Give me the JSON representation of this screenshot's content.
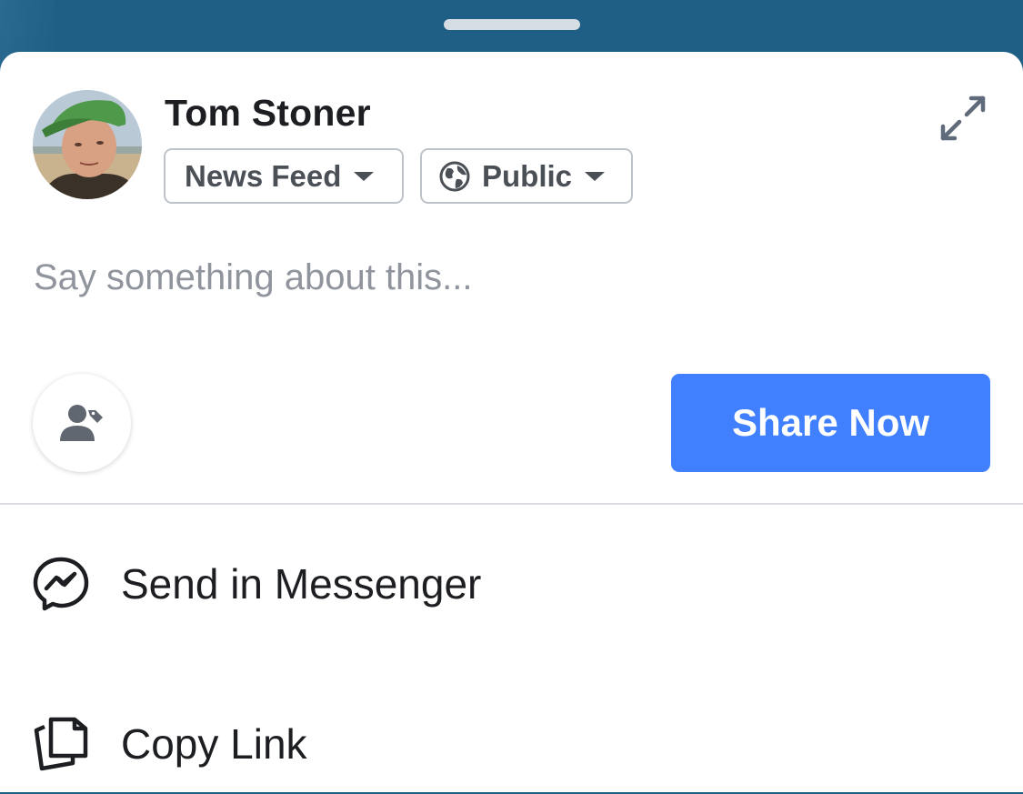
{
  "composer": {
    "user_name": "Tom Stoner",
    "audience_label": "News Feed",
    "privacy_label": "Public",
    "placeholder": "Say something about this...",
    "share_label": "Share Now"
  },
  "actions": [
    {
      "label": "Send in Messenger",
      "icon": "messenger-icon"
    },
    {
      "label": "Copy Link",
      "icon": "copy-link-icon"
    }
  ],
  "icons": {
    "expand": "expand-icon",
    "tag": "tag-people-icon",
    "privacy": "globe-icon",
    "caret": "caret-down-icon"
  },
  "colors": {
    "primary": "#4080ff",
    "backdrop": "#1f5f85",
    "text": "#1c1e21",
    "secondary_text": "#4b4f56",
    "placeholder": "#90949c"
  }
}
